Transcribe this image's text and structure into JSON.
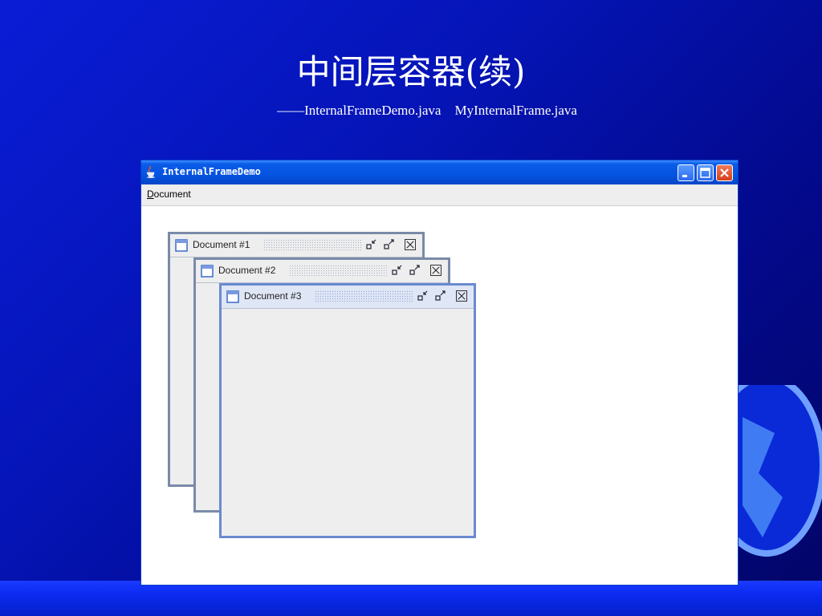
{
  "slide": {
    "title": "中间层容器(续)",
    "subtitle": "——InternalFrameDemo.java    MyInternalFrame.java"
  },
  "window": {
    "title": "InternalFrameDemo",
    "menu": {
      "document_label": "Document",
      "mnemonic": "D",
      "rest": "ocument"
    }
  },
  "internal_frames": [
    {
      "title": "Document #1"
    },
    {
      "title": "Document #2"
    },
    {
      "title": "Document #3"
    }
  ],
  "icons": {
    "app": "java-cup-icon",
    "frame": "document-window-icon",
    "iconify": "iconify-icon",
    "maximize": "maximize-icon",
    "close": "close-icon"
  },
  "colors": {
    "slide_background": "#0515b8",
    "title_bar": "#0553e0",
    "close_button": "#d4401a"
  }
}
